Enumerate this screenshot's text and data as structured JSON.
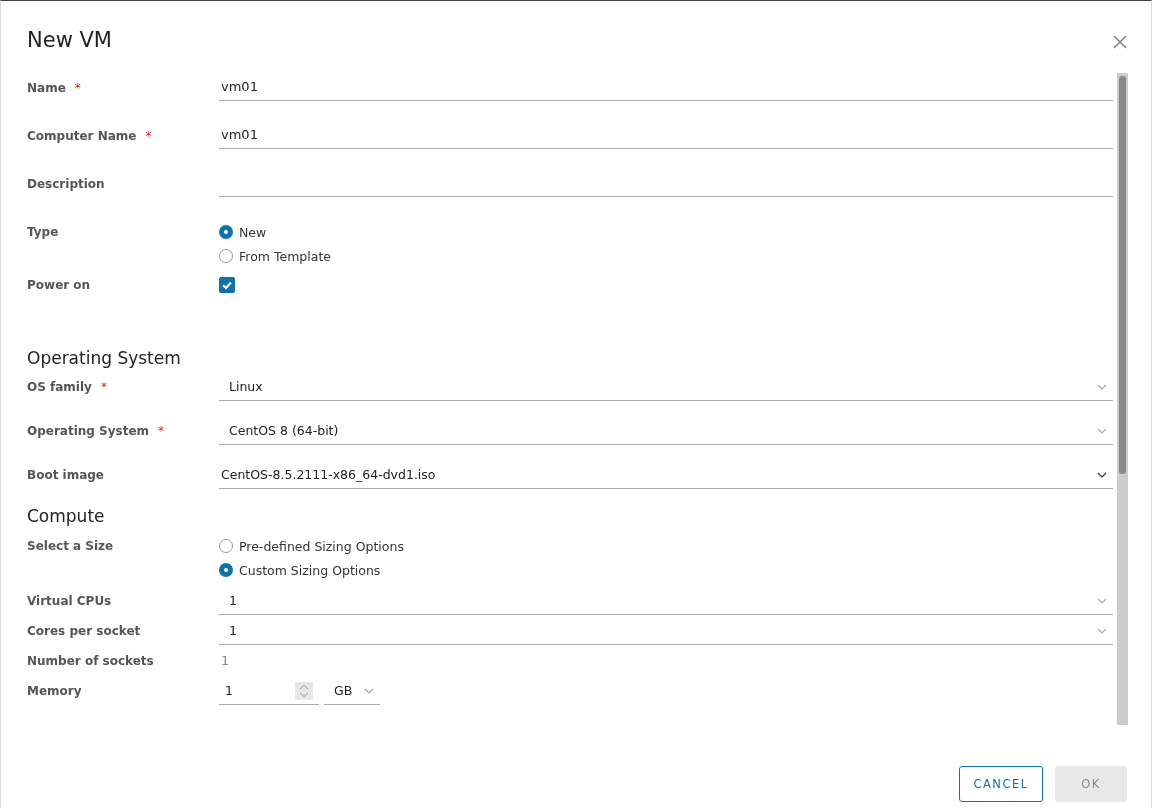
{
  "dialog": {
    "title": "New VM"
  },
  "form": [
    {
      "kind": "text",
      "label": "Name",
      "required_mark": "*",
      "value": "vm01"
    },
    {
      "kind": "text",
      "label": "Computer Name",
      "required_mark": "*",
      "value": "vm01"
    },
    {
      "kind": "text",
      "label": "Description"
    },
    {
      "kind": "radio",
      "label": "Type",
      "options": [
        {
          "label": "New",
          "selected": true
        },
        {
          "label": "From Template",
          "selected": false
        }
      ]
    },
    {
      "kind": "checkbox",
      "label": "Power on",
      "checked": true
    },
    {
      "kind": "heading",
      "label": "Operating System"
    },
    {
      "kind": "select",
      "label": "OS family",
      "required_mark": "*",
      "value": "Linux"
    },
    {
      "kind": "select",
      "label": "Operating System",
      "required_mark": "*",
      "value": "CentOS 8 (64-bit)"
    },
    {
      "kind": "native-select",
      "label": "Boot image",
      "value": "CentOS-8.5.2111-x86_64-dvd1.iso"
    },
    {
      "kind": "heading",
      "label": "Compute"
    },
    {
      "kind": "radio",
      "label": "Select a Size",
      "options": [
        {
          "label": "Pre-defined Sizing Options",
          "selected": false
        },
        {
          "label": "Custom Sizing Options",
          "selected": true
        }
      ]
    },
    {
      "kind": "select",
      "label": "Virtual CPUs",
      "value": "1"
    },
    {
      "kind": "select",
      "label": "Cores per socket",
      "value": "1"
    },
    {
      "kind": "static",
      "label": "Number of sockets",
      "value": "1"
    },
    {
      "kind": "memory",
      "label": "Memory",
      "value": "1",
      "unit": "GB"
    }
  ],
  "buttons": [
    {
      "label": "CANCEL",
      "kind": "outline",
      "disabled": false
    },
    {
      "label": "OK",
      "kind": "primary",
      "disabled": true
    }
  ]
}
